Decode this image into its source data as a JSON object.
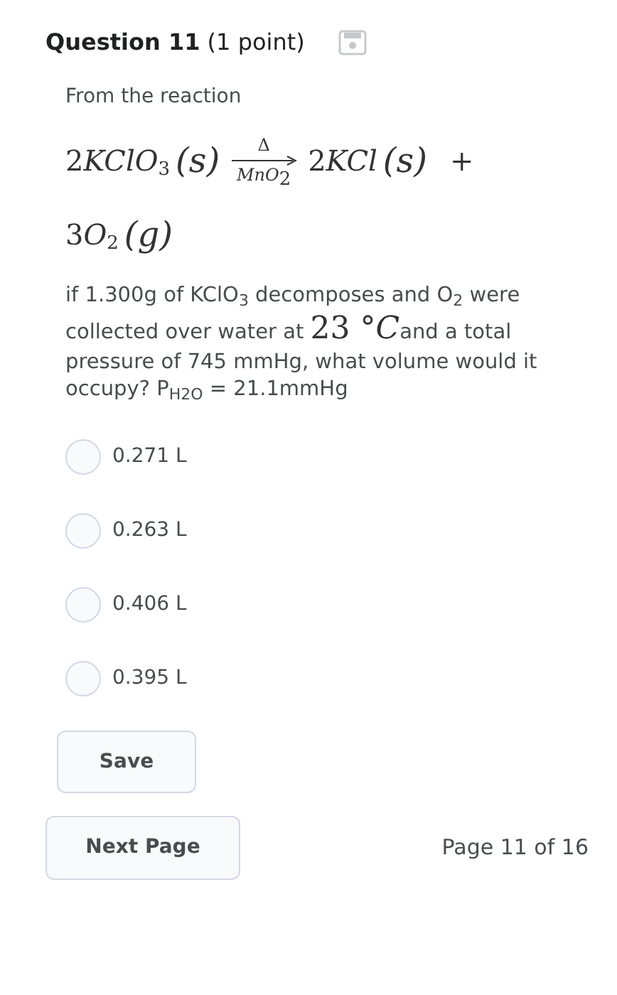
{
  "question": {
    "title": "Question 11",
    "points": "(1 point)"
  },
  "intro": "From the reaction",
  "equation": {
    "reactant": {
      "coefficient": "2",
      "formula": "KClO",
      "subscript": "3",
      "state": "(s)"
    },
    "above_arrow": "Δ",
    "below_arrow": {
      "formula": "MnO",
      "subscript": "2"
    },
    "product": {
      "coefficient": "2",
      "formula": "KCl",
      "state": "(s)"
    },
    "plus": "+",
    "product2": {
      "coefficient": "3",
      "formula": "O",
      "subscript": "2",
      "state": "(g)"
    }
  },
  "prompt": [
    {
      "kind": "text",
      "text": "if 1.300g of KClO$_{3}$ decomposes and O$_{2}$ were collected over water at "
    },
    {
      "kind": "math",
      "text": "23 °",
      "unit": "C"
    },
    {
      "kind": "text",
      "text": "and a total pressure of 745 mmHg, what volume would it occupy? P$_{H2O}$ = 21.1mmHg"
    }
  ],
  "options": [
    {
      "label": "0.271 L",
      "selected": false
    },
    {
      "label": "0.263 L",
      "selected": false
    },
    {
      "label": "0.406 L",
      "selected": false
    },
    {
      "label": "0.395 L",
      "selected": false
    }
  ],
  "save_button": "Save",
  "next_button": "Next Page",
  "page_indicator": "Page 11 of 16"
}
